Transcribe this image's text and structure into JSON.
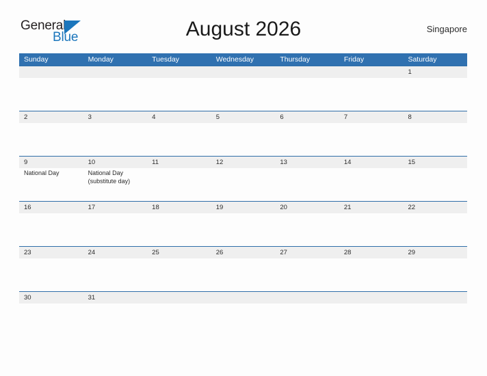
{
  "brand": {
    "word_one": "General",
    "word_two": "Blue",
    "triangle_color": "#1b76bc",
    "word_one_color": "#231f20",
    "word_two_color": "#1b76bc"
  },
  "header": {
    "title": "August 2026",
    "locale": "Singapore"
  },
  "theme": {
    "header_blue": "#3071b0",
    "row_divider_blue": "#2e6da8",
    "daynum_band": "#efefef",
    "page_background": "#fdfdfd"
  },
  "calendar": {
    "month": "August",
    "year": "2026",
    "weekday_headers": [
      "Sunday",
      "Monday",
      "Tuesday",
      "Wednesday",
      "Thursday",
      "Friday",
      "Saturday"
    ],
    "weeks": [
      {
        "days": [
          {
            "num": "",
            "event": ""
          },
          {
            "num": "",
            "event": ""
          },
          {
            "num": "",
            "event": ""
          },
          {
            "num": "",
            "event": ""
          },
          {
            "num": "",
            "event": ""
          },
          {
            "num": "",
            "event": ""
          },
          {
            "num": "1",
            "event": ""
          }
        ]
      },
      {
        "days": [
          {
            "num": "2",
            "event": ""
          },
          {
            "num": "3",
            "event": ""
          },
          {
            "num": "4",
            "event": ""
          },
          {
            "num": "5",
            "event": ""
          },
          {
            "num": "6",
            "event": ""
          },
          {
            "num": "7",
            "event": ""
          },
          {
            "num": "8",
            "event": ""
          }
        ]
      },
      {
        "days": [
          {
            "num": "9",
            "event": "National Day"
          },
          {
            "num": "10",
            "event": "National Day\n(substitute day)"
          },
          {
            "num": "11",
            "event": ""
          },
          {
            "num": "12",
            "event": ""
          },
          {
            "num": "13",
            "event": ""
          },
          {
            "num": "14",
            "event": ""
          },
          {
            "num": "15",
            "event": ""
          }
        ]
      },
      {
        "days": [
          {
            "num": "16",
            "event": ""
          },
          {
            "num": "17",
            "event": ""
          },
          {
            "num": "18",
            "event": ""
          },
          {
            "num": "19",
            "event": ""
          },
          {
            "num": "20",
            "event": ""
          },
          {
            "num": "21",
            "event": ""
          },
          {
            "num": "22",
            "event": ""
          }
        ]
      },
      {
        "days": [
          {
            "num": "23",
            "event": ""
          },
          {
            "num": "24",
            "event": ""
          },
          {
            "num": "25",
            "event": ""
          },
          {
            "num": "26",
            "event": ""
          },
          {
            "num": "27",
            "event": ""
          },
          {
            "num": "28",
            "event": ""
          },
          {
            "num": "29",
            "event": ""
          }
        ]
      },
      {
        "days": [
          {
            "num": "30",
            "event": ""
          },
          {
            "num": "31",
            "event": ""
          },
          {
            "num": "",
            "event": ""
          },
          {
            "num": "",
            "event": ""
          },
          {
            "num": "",
            "event": ""
          },
          {
            "num": "",
            "event": ""
          },
          {
            "num": "",
            "event": ""
          }
        ]
      }
    ]
  }
}
